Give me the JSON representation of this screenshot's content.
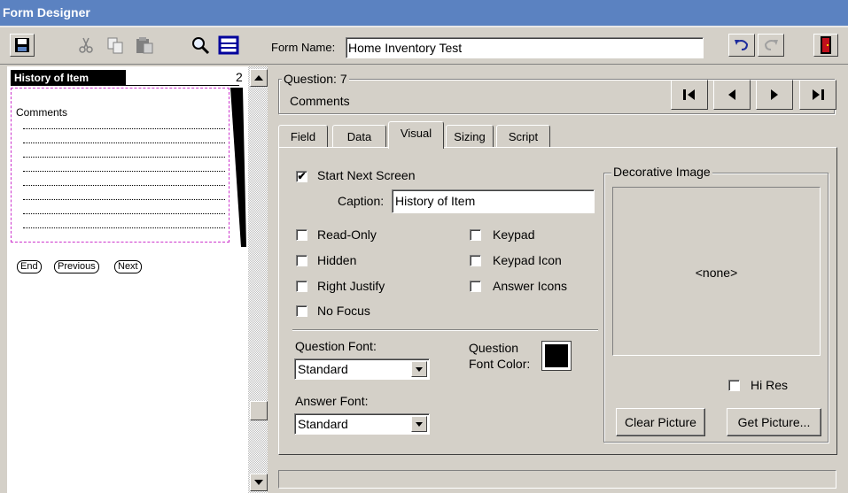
{
  "window": {
    "title": "Form Designer"
  },
  "toolbar": {
    "save_icon": "save-icon",
    "cut_icon": "cut-icon",
    "copy_icon": "copy-icon",
    "paste_icon": "paste-icon",
    "preview_icon": "magnifier-icon",
    "form_icon": "form-layout-icon",
    "form_name_label": "Form Name:",
    "form_name_value": "Home Inventory Test",
    "undo_icon": "undo-icon",
    "redo_icon": "redo-icon",
    "exit_icon": "exit-door-icon"
  },
  "preview": {
    "screen_title": "History of Item",
    "screen_number": "2",
    "question_caption": "Comments",
    "buttons": [
      "End",
      "Previous",
      "Next"
    ]
  },
  "question": {
    "group_label": "Question: 7",
    "name": "Comments"
  },
  "nav": {
    "first": "first-icon",
    "prev": "previous-icon",
    "next": "next-icon",
    "last": "last-icon"
  },
  "tabs": [
    "Field",
    "Data",
    "Visual",
    "Sizing",
    "Script"
  ],
  "active_tab": "Visual",
  "visual": {
    "start_next_screen": {
      "label": "Start Next Screen",
      "checked": true
    },
    "caption_label": "Caption:",
    "caption_value": "History of Item",
    "options_left": [
      {
        "label": "Read-Only",
        "checked": false
      },
      {
        "label": "Hidden",
        "checked": false
      },
      {
        "label": "Right Justify",
        "checked": false
      },
      {
        "label": "No Focus",
        "checked": false
      }
    ],
    "options_right": [
      {
        "label": "Keypad",
        "checked": false
      },
      {
        "label": "Keypad Icon",
        "checked": false
      },
      {
        "label": "Answer Icons",
        "checked": false
      }
    ],
    "question_font_label": "Question Font:",
    "question_font_value": "Standard",
    "answer_font_label": "Answer Font:",
    "answer_font_value": "Standard",
    "question_font_color_label_1": "Question",
    "question_font_color_label_2": "Font Color:",
    "question_font_color": "#000000",
    "decorative_image_label": "Decorative Image",
    "decorative_image_value": "<none>",
    "hi_res_label": "Hi Res",
    "hi_res_checked": false,
    "clear_picture": "Clear Picture",
    "get_picture": "Get Picture..."
  }
}
